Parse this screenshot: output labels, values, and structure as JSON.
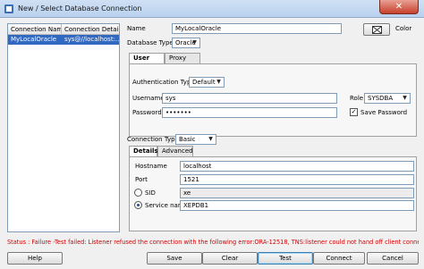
{
  "window": {
    "title": "New / Select Database Connection",
    "close_glyph": "✕"
  },
  "connections": {
    "columns": [
      "Connection Name",
      "Connection Details"
    ],
    "rows": [
      {
        "name": "MyLocalOracle",
        "details": "sys@//localhost:..."
      }
    ]
  },
  "form": {
    "name_label": "Name",
    "name_value": "MyLocalOracle",
    "color_label": "Color",
    "db_type_label": "Database Type",
    "db_type_value": "Oracle",
    "auth_tabs": [
      "User Info",
      "Proxy User"
    ],
    "auth_type_label": "Authentication Type",
    "auth_type_value": "Default",
    "username_label": "Username",
    "username_value": "sys",
    "role_label": "Role",
    "role_value": "SYSDBA",
    "password_label": "Password",
    "password_value": "•••••••",
    "save_password_label": "Save Password",
    "save_password_checked": true,
    "connection_type_label": "Connection Type",
    "connection_type_value": "Basic",
    "conn_tabs": [
      "Details",
      "Advanced"
    ],
    "hostname_label": "Hostname",
    "hostname_value": "localhost",
    "port_label": "Port",
    "port_value": "1521",
    "sid_label": "SID",
    "sid_value": "xe",
    "service_name_label": "Service name",
    "service_name_value": "XEPDB1",
    "selected_identifier": "service_name"
  },
  "status": {
    "text": "Status : Failure -Test failed: Listener refused the connection with the following error:ORA-12518, TNS:listener could not hand off client connection",
    "color": "#d10000"
  },
  "buttons": {
    "help": "Help",
    "save": "Save",
    "clear": "Clear",
    "test": "Test",
    "connect": "Connect",
    "cancel": "Cancel"
  },
  "colors": {
    "selection": "#3168c1",
    "title_bar": "#c4d8f1"
  }
}
